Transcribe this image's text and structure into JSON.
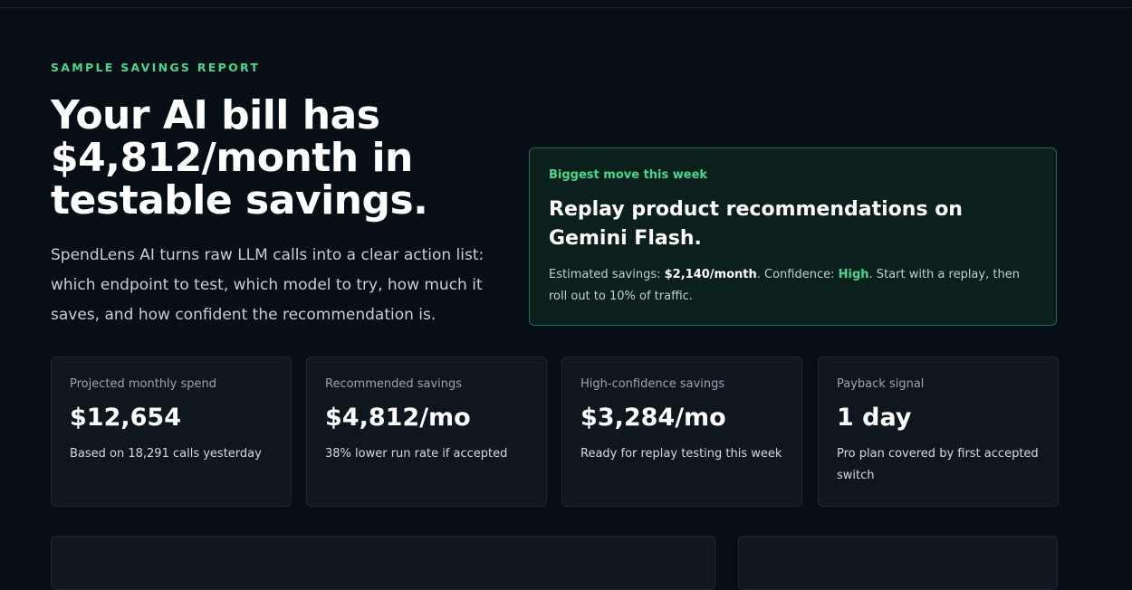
{
  "hero": {
    "eyebrow": "SAMPLE SAVINGS REPORT",
    "headline": "Your AI bill has $4,812/month in testable savings.",
    "lede": "SpendLens AI turns raw LLM calls into a clear action list: which endpoint to test, which model to try, how much it saves, and how confident the recommendation is."
  },
  "callout": {
    "kicker": "Biggest move this week",
    "title": "Replay product recommendations on Gemini Flash.",
    "savings_prefix": "Estimated savings: ",
    "savings_value": "$2,140/month",
    "confidence_prefix": ". Confidence: ",
    "confidence_value": "High",
    "body_suffix": ". Start with a replay, then roll out to 10% of traffic."
  },
  "stats": [
    {
      "label": "Projected monthly spend",
      "value": "$12,654",
      "note": "Based on 18,291 calls yesterday"
    },
    {
      "label": "Recommended savings",
      "value": "$4,812/mo",
      "note": "38% lower run rate if accepted"
    },
    {
      "label": "High-confidence savings",
      "value": "$3,284/mo",
      "note": "Ready for replay testing this week"
    },
    {
      "label": "Payback signal",
      "value": "1 day",
      "note": "Pro plan covered by first accepted switch"
    }
  ],
  "colors": {
    "accent": "#43d98e",
    "background": "#070e15",
    "card": "#0e161e",
    "callout_bg": "#0b1f1c",
    "callout_border": "#1f6b4b"
  }
}
